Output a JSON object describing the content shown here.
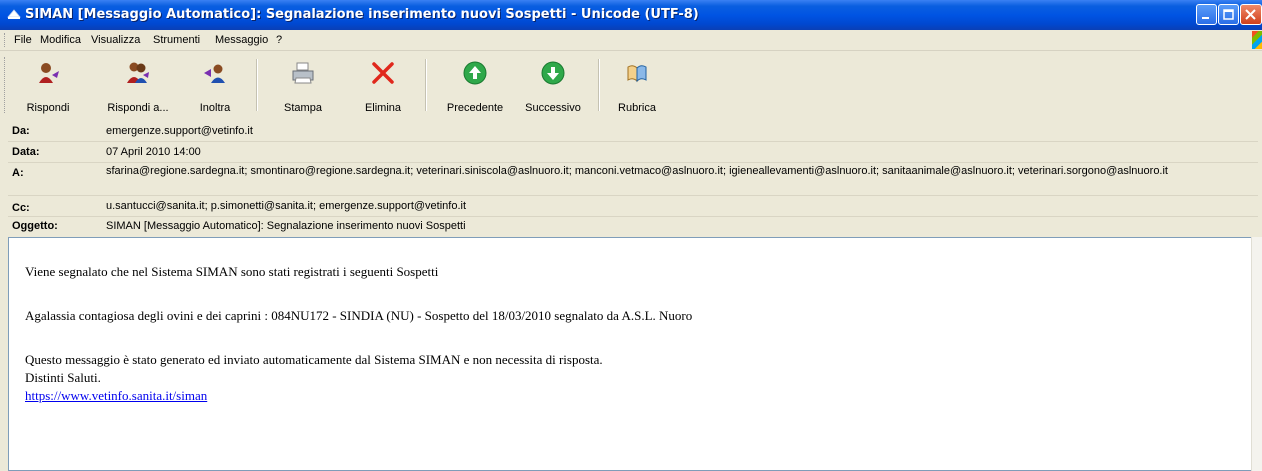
{
  "window": {
    "title": "SIMAN [Messaggio Automatico]: Segnalazione inserimento nuovi Sospetti - Unicode (UTF-8)"
  },
  "menu": [
    "File",
    "Modifica",
    "Visualizza",
    "Strumenti",
    "Messaggio",
    "?"
  ],
  "toolbar": {
    "rispondi": "Rispondi",
    "rispondi_tutti": "Rispondi a...",
    "inoltra": "Inoltra",
    "stampa": "Stampa",
    "elimina": "Elimina",
    "precedente": "Precedente",
    "successivo": "Successivo",
    "rubrica": "Rubrica"
  },
  "headers": {
    "da_label": "Da:",
    "da_value": "emergenze.support@vetinfo.it",
    "data_label": "Data:",
    "data_value": "07 April 2010 14:00",
    "a_label": "A:",
    "a_value": "sfarina@regione.sardegna.it; smontinaro@regione.sardegna.it; veterinari.siniscola@aslnuoro.it; manconi.vetmaco@aslnuoro.it; igieneallevamenti@aslnuoro.it; sanitaanimale@aslnuoro.it; veterinari.sorgono@aslnuoro.it",
    "cc_label": "Cc:",
    "cc_value": "u.santucci@sanita.it; p.simonetti@sanita.it; emergenze.support@vetinfo.it",
    "oggetto_label": "Oggetto:",
    "oggetto_value": "SIMAN [Messaggio Automatico]: Segnalazione inserimento nuovi Sospetti"
  },
  "body": {
    "line1": "Viene segnalato che nel Sistema SIMAN sono stati registrati i seguenti Sospetti",
    "line2": "Agalassia contagiosa degli ovini e dei caprini : 084NU172 - SINDIA (NU) - Sospetto del 18/03/2010 segnalato da A.S.L. Nuoro",
    "line3": "Questo messaggio è stato generato ed inviato automaticamente dal Sistema SIMAN e non necessita di risposta.",
    "line4": "Distinti Saluti.",
    "link": "https://www.vetinfo.sanita.it/siman"
  },
  "colors": {
    "titlebar": "#0054e3",
    "toolbar_bg": "#ece9d8",
    "link": "#0000ee"
  }
}
